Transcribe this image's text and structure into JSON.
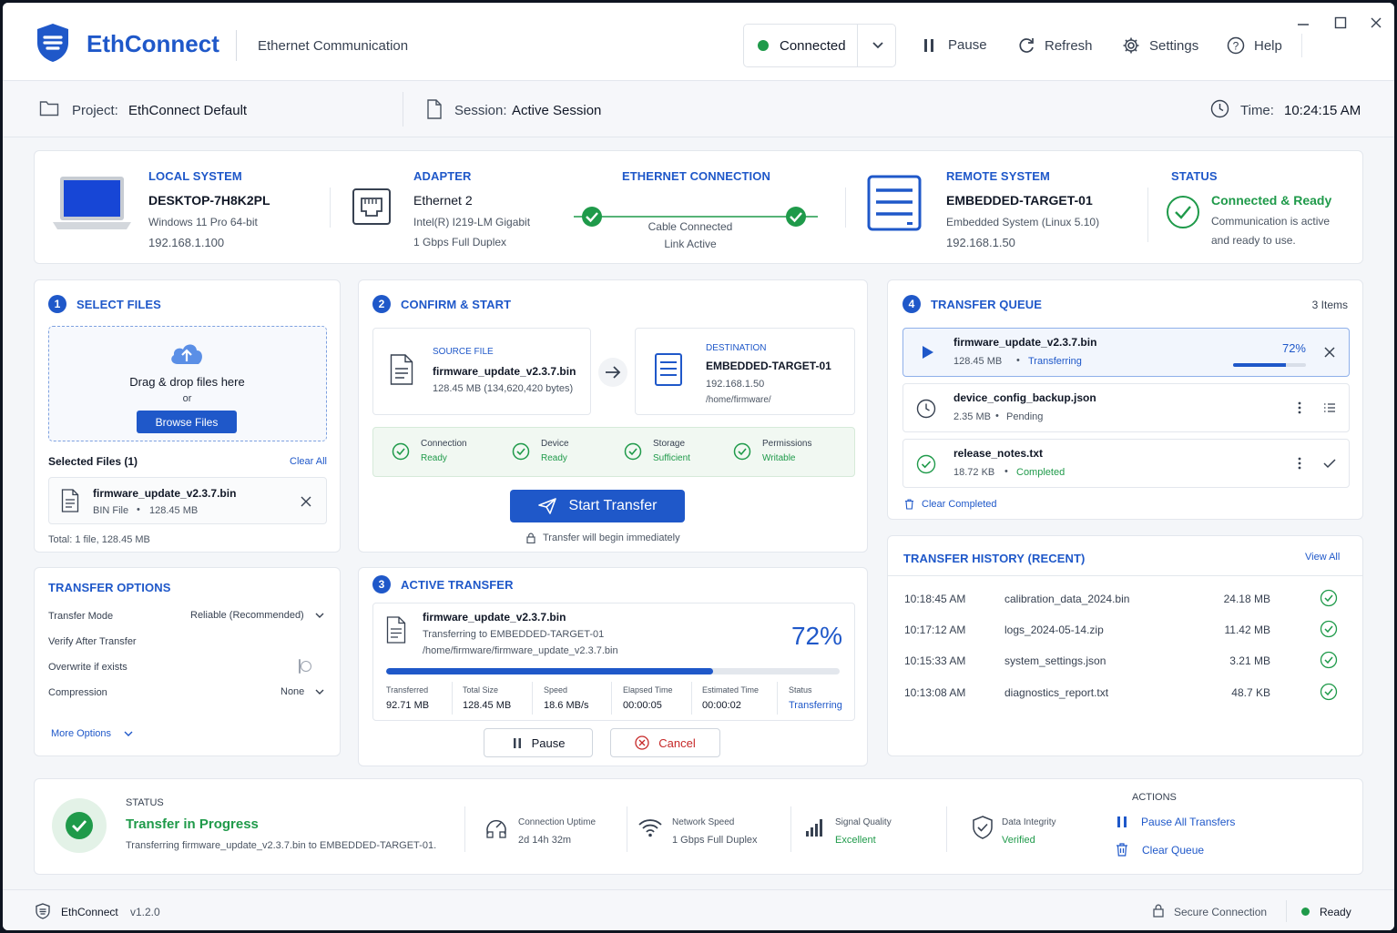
{
  "app": {
    "name": "EthConnect",
    "subtitle": "Ethernet Communication",
    "version": "v1.2.0"
  },
  "toolbar": {
    "connection_state": "Connected",
    "pause": "Pause",
    "refresh": "Refresh",
    "settings": "Settings",
    "help": "Help"
  },
  "infobar": {
    "project_label": "Project:",
    "project_value": "EthConnect Default",
    "session_label": "Session:",
    "session_value": "Active Session",
    "time_label": "Time:",
    "time_value": "10:24:15 AM"
  },
  "topology": {
    "local": {
      "title": "LOCAL SYSTEM",
      "name": "DESKTOP-7H8K2PL",
      "os": "Windows 11 Pro 64-bit",
      "ip": "192.168.1.100"
    },
    "adapter": {
      "title": "ADAPTER",
      "name": "Ethernet 2",
      "model": "Intel(R) I219-LM Gigabit",
      "speed": "1 Gbps Full Duplex"
    },
    "ethernet": {
      "title": "ETHERNET CONNECTION",
      "line1": "Cable Connected",
      "line2": "Link Active"
    },
    "remote": {
      "title": "REMOTE SYSTEM",
      "name": "EMBEDDED-TARGET-01",
      "os": "Embedded System (Linux 5.10)",
      "ip": "192.168.1.50"
    },
    "status": {
      "title": "STATUS",
      "value": "Connected & Ready",
      "desc1": "Communication is active",
      "desc2": "and ready to use."
    }
  },
  "select_files": {
    "step": "1",
    "title": "SELECT FILES",
    "drop_text": "Drag & drop files here",
    "or": "or",
    "browse": "Browse Files",
    "selected_label": "Selected Files (1)",
    "clear_all": "Clear All",
    "file_name": "firmware_update_v2.3.7.bin",
    "file_type": "BIN File",
    "file_size": "128.45 MB",
    "total": "Total: 1 file, 128.45 MB"
  },
  "transfer_options": {
    "title": "TRANSFER OPTIONS",
    "mode_label": "Transfer Mode",
    "mode_value": "Reliable (Recommended)",
    "verify_label": "Verify After Transfer",
    "verify_on": true,
    "overwrite_label": "Overwrite if exists",
    "overwrite_on": false,
    "compression_label": "Compression",
    "compression_value": "None",
    "more": "More Options"
  },
  "confirm": {
    "step": "2",
    "title": "CONFIRM & START",
    "source_label": "SOURCE FILE",
    "source_name": "firmware_update_v2.3.7.bin",
    "source_size": "128.45 MB (134,620,420 bytes)",
    "dest_label": "DESTINATION",
    "dest_name": "EMBEDDED-TARGET-01",
    "dest_ip": "192.168.1.50",
    "dest_path": "/home/firmware/",
    "checks": [
      {
        "label": "Connection",
        "value": "Ready"
      },
      {
        "label": "Device",
        "value": "Ready"
      },
      {
        "label": "Storage",
        "value": "Sufficient"
      },
      {
        "label": "Permissions",
        "value": "Writable"
      }
    ],
    "start": "Start Transfer",
    "note": "Transfer will begin immediately"
  },
  "active": {
    "step": "3",
    "title": "ACTIVE TRANSFER",
    "file": "firmware_update_v2.3.7.bin",
    "to": "Transferring to EMBEDDED-TARGET-01",
    "path": "/home/firmware/firmware_update_v2.3.7.bin",
    "percent": "72%",
    "progress": 0.72,
    "stats": [
      {
        "label": "Transferred",
        "value": "92.71 MB"
      },
      {
        "label": "Total Size",
        "value": "128.45 MB"
      },
      {
        "label": "Speed",
        "value": "18.6 MB/s"
      },
      {
        "label": "Elapsed Time",
        "value": "00:00:05"
      },
      {
        "label": "Estimated Time",
        "value": "00:00:02"
      },
      {
        "label": "Status",
        "value": "Transferring"
      }
    ],
    "pause": "Pause",
    "cancel": "Cancel"
  },
  "queue": {
    "step": "4",
    "title": "TRANSFER QUEUE",
    "count": "3 Items",
    "items": [
      {
        "name": "firmware_update_v2.3.7.bin",
        "size": "128.45 MB",
        "state": "Transferring",
        "percent": "72%",
        "progress": 0.72
      },
      {
        "name": "device_config_backup.json",
        "size": "2.35 MB",
        "state": "Pending"
      },
      {
        "name": "release_notes.txt",
        "size": "18.72 KB",
        "state": "Completed"
      }
    ],
    "clear": "Clear Completed"
  },
  "history": {
    "title": "TRANSFER HISTORY (RECENT)",
    "view_all": "View All",
    "rows": [
      {
        "time": "10:18:45 AM",
        "file": "calibration_data_2024.bin",
        "size": "24.18 MB"
      },
      {
        "time": "10:17:12 AM",
        "file": "logs_2024-05-14.zip",
        "size": "11.42 MB"
      },
      {
        "time": "10:15:33 AM",
        "file": "system_settings.json",
        "size": "3.21 MB"
      },
      {
        "time": "10:13:08 AM",
        "file": "diagnostics_report.txt",
        "size": "48.7 KB"
      }
    ]
  },
  "statusbar": {
    "label": "STATUS",
    "title": "Transfer in Progress",
    "desc": "Transferring firmware_update_v2.3.7.bin to EMBEDDED-TARGET-01.",
    "metrics": [
      {
        "label": "Connection Uptime",
        "value": "2d 14h 32m"
      },
      {
        "label": "Network Speed",
        "value": "1 Gbps Full Duplex"
      },
      {
        "label": "Signal Quality",
        "value": "Excellent"
      },
      {
        "label": "Data Integrity",
        "value": "Verified"
      }
    ],
    "actions_label": "ACTIONS",
    "pause_all": "Pause All Transfers",
    "clear_queue": "Clear Queue"
  },
  "footer": {
    "secure": "Secure Connection",
    "ready": "Ready"
  },
  "colors": {
    "accent": "#1f58c9",
    "success": "#1f9a4a",
    "background": "#f4f6f9"
  }
}
